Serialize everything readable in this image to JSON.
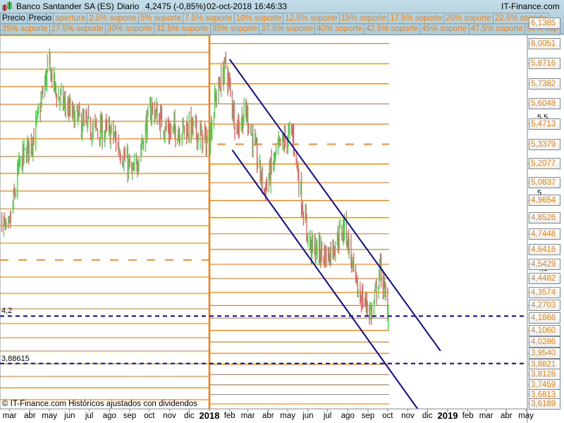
{
  "header": {
    "instrument": "Banco Santander SA (ES)",
    "period": "Diario",
    "price": "4,2475 (-0,85%)",
    "datetime": "02-oct-2018 16:46:33",
    "brand": "IT-Finance.com"
  },
  "legend_row1": [
    "Precio",
    "Precio",
    "apertura",
    "2.5% soporte",
    "5% soporte",
    "7.5% soporte",
    "10% soporte",
    "12.5% soporte",
    "15% soporte",
    "17.5% soporte",
    "20% soporte",
    "22.5% soporte"
  ],
  "legend_row2": [
    "25% soporte",
    "27.5% soporte",
    "30% soporte",
    "32.5% soporte",
    "35% soporte",
    "37.5% soporte",
    "40% soporte",
    "42.5% soporte",
    "45% soporte",
    "47.5% soporte",
    "50% sop"
  ],
  "footer": "© IT-Finance.com  Históricos ajustados con dividendos",
  "colors": {
    "up": "#4fd24f",
    "down": "#e06262",
    "support": "#f07f10",
    "channel": "#0a0a96",
    "hline": "#0a0a80"
  },
  "chart_data": {
    "type": "candlestick",
    "title": "Banco Santander SA (ES) Diario",
    "ylim": [
      3.586,
      6.073
    ],
    "y_ticks": [
      "6,1385",
      "6,0051",
      "5,8716",
      "5,7382",
      "5,6048",
      "5,4713",
      "5,3379",
      "5,2077",
      "5,0837",
      "4,9654",
      "4,8526",
      "4,7448",
      "4,6416",
      "4,5429",
      "4,4482",
      "4,3574",
      "4,2703",
      "4,1866",
      "4,1060",
      "4,0286",
      "3,9540",
      "3,8821",
      "3,8128",
      "3,7459",
      "3,6813",
      "3,6189"
    ],
    "x_ticks": [
      [
        "2017-03-01",
        "mar"
      ],
      [
        "2017-04-01",
        "abr"
      ],
      [
        "2017-05-01",
        "may"
      ],
      [
        "2017-06-01",
        "jun"
      ],
      [
        "2017-07-01",
        "jul"
      ],
      [
        "2017-08-01",
        "ago"
      ],
      [
        "2017-09-01",
        "sep"
      ],
      [
        "2017-10-01",
        "oct"
      ],
      [
        "2017-11-01",
        "nov"
      ],
      [
        "2017-12-01",
        "dic"
      ],
      [
        "2018-01-01",
        "2018"
      ],
      [
        "2018-02-01",
        "feb"
      ],
      [
        "2018-03-01",
        "mar"
      ],
      [
        "2018-04-01",
        "abr"
      ],
      [
        "2018-05-01",
        "may"
      ],
      [
        "2018-06-01",
        "jun"
      ],
      [
        "2018-07-01",
        "jul"
      ],
      [
        "2018-08-01",
        "ago"
      ],
      [
        "2018-09-01",
        "sep"
      ],
      [
        "2018-10-01",
        "oct"
      ],
      [
        "2018-11-01",
        "nov"
      ],
      [
        "2018-12-01",
        "dic"
      ],
      [
        "2019-01-01",
        "2019"
      ],
      [
        "2019-02-01",
        "feb"
      ],
      [
        "2019-03-01",
        "mar"
      ],
      [
        "2019-04-01",
        "abr"
      ],
      [
        "2019-05-01",
        "may"
      ]
    ],
    "close_anchors": [
      [
        "2017-02-17",
        4.85
      ],
      [
        "2017-02-26",
        4.72
      ],
      [
        "2017-03-16",
        5.2
      ],
      [
        "2017-04-08",
        5.4
      ],
      [
        "2017-04-30",
        5.87
      ],
      [
        "2017-05-11",
        5.68
      ],
      [
        "2017-06-01",
        5.55
      ],
      [
        "2017-06-28",
        5.45
      ],
      [
        "2017-08-05",
        5.41
      ],
      [
        "2017-09-06",
        5.13
      ],
      [
        "2017-10-04",
        5.58
      ],
      [
        "2017-10-31",
        5.42
      ],
      [
        "2017-12-03",
        5.45
      ],
      [
        "2017-12-31",
        5.34
      ],
      [
        "2018-01-10",
        5.64
      ],
      [
        "2018-01-26",
        5.86
      ],
      [
        "2018-02-11",
        5.45
      ],
      [
        "2018-02-27",
        5.55
      ],
      [
        "2018-03-26",
        5.03
      ],
      [
        "2018-04-17",
        5.31
      ],
      [
        "2018-05-08",
        5.42
      ],
      [
        "2018-05-25",
        4.89
      ],
      [
        "2018-06-04",
        4.66
      ],
      [
        "2018-07-01",
        4.6
      ],
      [
        "2018-07-28",
        4.8
      ],
      [
        "2018-08-14",
        4.38
      ],
      [
        "2018-09-07",
        4.22
      ],
      [
        "2018-09-20",
        4.52
      ],
      [
        "2018-09-30",
        4.25
      ],
      [
        "2018-10-02",
        4.2475
      ]
    ],
    "supports_2017": [
      6.059,
      5.947,
      5.835,
      5.719,
      5.602,
      5.49,
      5.374,
      5.257,
      5.145,
      5.028,
      4.911,
      4.799,
      4.683,
      4.459,
      4.351,
      4.249,
      4.151,
      4.057,
      3.969,
      3.885,
      3.801,
      3.726,
      3.647
    ],
    "opening_2017": 4.571,
    "supports_2018": [
      6.0051,
      5.8716,
      5.7382,
      5.6048,
      5.4713,
      5.2077,
      5.0837,
      4.9654,
      4.8526,
      4.7448,
      4.6416,
      4.5429,
      4.4482,
      4.3574,
      4.2703,
      4.1866,
      4.106,
      4.0286,
      3.954,
      3.8821,
      3.8128,
      3.7459,
      3.6813,
      3.6189
    ],
    "opening_2018": 5.3379,
    "horizontal_levels": [
      {
        "value": 4.2,
        "label": "4,2"
      },
      {
        "value": 3.88615,
        "label": "3,88615"
      }
    ],
    "channel": [
      {
        "name": "upper",
        "from": [
          "2018-02-01",
          5.9
        ],
        "to": [
          "2018-12-21",
          3.97
        ]
      },
      {
        "name": "lower",
        "from": [
          "2018-02-05",
          5.3
        ],
        "to": [
          "2018-11-16",
          3.586
        ]
      }
    ],
    "axis_marks": [
      "5,5",
      "5",
      "4,5"
    ]
  }
}
